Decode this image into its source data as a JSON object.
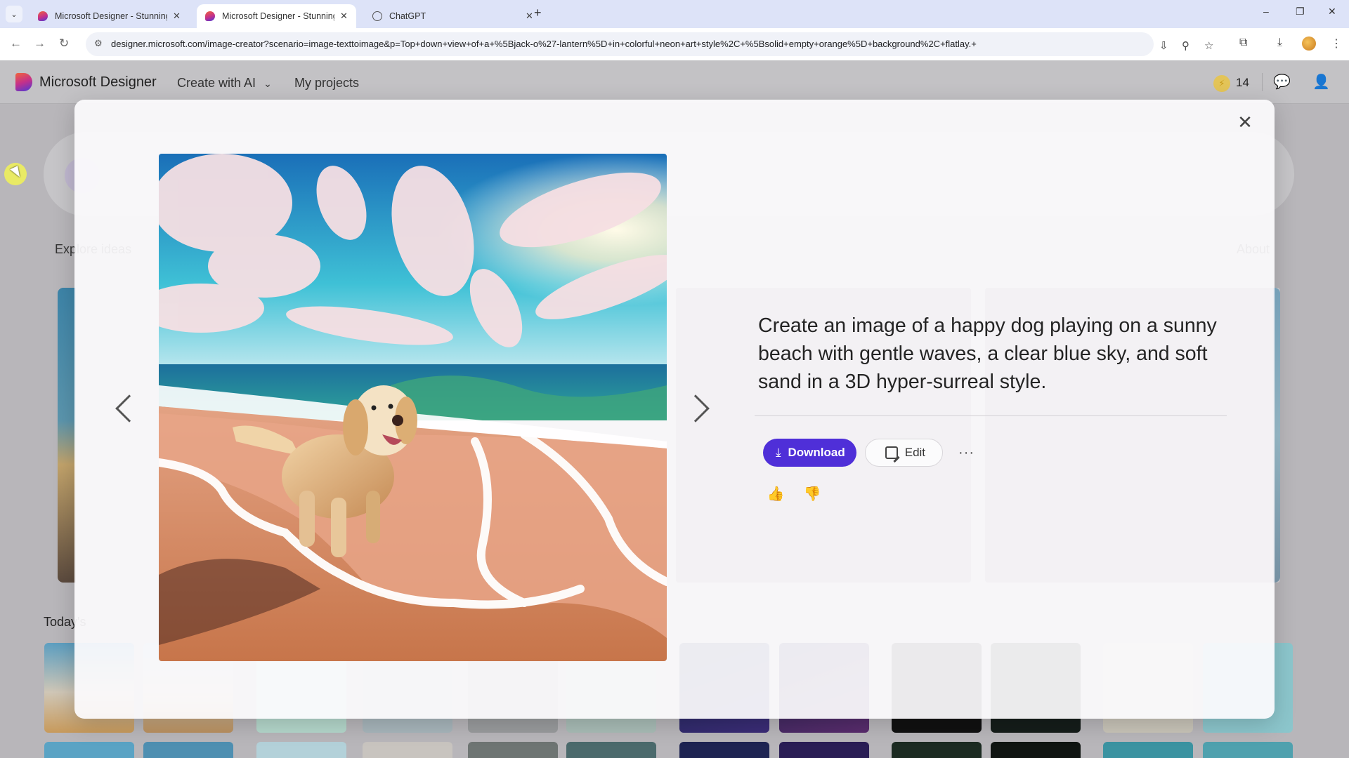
{
  "browser": {
    "tabs": [
      {
        "title": "Microsoft Designer - Stunning d",
        "active": false,
        "icon": "designer-favicon"
      },
      {
        "title": "Microsoft Designer - Stunning d",
        "active": true,
        "icon": "designer-favicon"
      },
      {
        "title": "ChatGPT",
        "active": false,
        "icon": "chatgpt-favicon"
      }
    ],
    "close_glyph": "✕",
    "new_tab_glyph": "+",
    "tab_menu_glyph": "⌄",
    "window_controls": {
      "minimize": "–",
      "restore": "❐",
      "close": "✕"
    },
    "nav": {
      "back": "←",
      "forward": "→",
      "reload": "↻"
    },
    "url": "designer.microsoft.com/image-creator?scenario=image-texttoimage&p=Top+down+view+of+a+%5Bjack-o%27-lantern%5D+in+colorful+neon+art+style%2C+%5Bsolid+empty+orange%5D+background%2C+flatlay.+",
    "site_info_glyph": "⚙",
    "omnibox_icons": {
      "install": "⇩",
      "zoom": "⚲",
      "bookmark": "☆"
    },
    "toolbar_icons": {
      "extensions": "⧉",
      "downloads": "⤓",
      "menu": "⋮"
    }
  },
  "app": {
    "brand": "Microsoft Designer",
    "nav": [
      {
        "label": "Create with AI",
        "has_dropdown": true
      },
      {
        "label": "My projects",
        "has_dropdown": false
      }
    ],
    "dropdown_glyph": "⌄",
    "boosts_count": "14",
    "boost_glyph": "⚡",
    "feedback_glyph": "💬",
    "account_glyph": "👤",
    "background": {
      "explore_label": "Explore ideas",
      "about_label": "About",
      "today_label": "Today's"
    }
  },
  "modal": {
    "close_glyph": "✕",
    "prev_label": "Previous image",
    "next_label": "Next image",
    "image_alt": "Golden retriever on a sunny beach with waves and swirling clouds in a 3D hyper-surreal style",
    "prompt": "Create an image of a happy dog playing on a sunny beach with gentle waves, a clear blue sky, and soft sand in a 3D hyper-surreal style.",
    "download_label": "Download",
    "download_glyph": "⤓",
    "edit_label": "Edit",
    "more_glyph": "···",
    "like_glyph": "👍",
    "dislike_glyph": "👎"
  },
  "colors": {
    "primary": "#4f2fd8",
    "overlay": "#b8b6ba",
    "tabbar": "#dde3f8"
  }
}
